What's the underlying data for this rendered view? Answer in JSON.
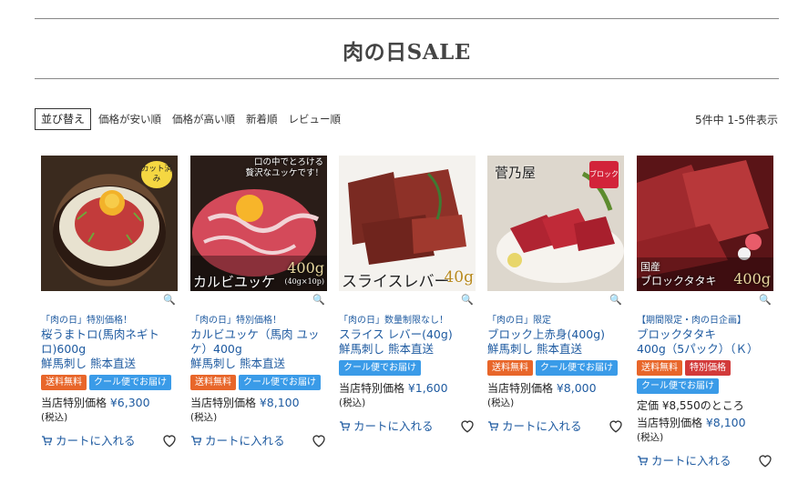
{
  "header": {
    "title": "肉の日SALE"
  },
  "sort": {
    "label": "並び替え",
    "options": [
      "価格が安い順",
      "価格が高い順",
      "新着順",
      "レビュー順"
    ]
  },
  "result_count": "5件中 1-5件表示",
  "products": [
    {
      "promo": "「肉の日」特別価格！",
      "name": "桜うまトロ(馬肉ネギトロ)600g\n鮮馬刺し 熊本直送",
      "badges": [
        {
          "text": "送料無料",
          "color": "#e8662a"
        },
        {
          "text": "クール便でお届け",
          "color": "#3a9be8"
        }
      ],
      "price_label": "当店特別価格",
      "price": "¥6,300",
      "tax": "(税込)",
      "cart": "カートに入れる",
      "image_tag": "カット済み"
    },
    {
      "promo": "「肉の日」特別価格！",
      "name": "カルビユッケ（馬肉 ユッケ）400g\n鮮馬刺し 熊本直送",
      "badges": [
        {
          "text": "送料無料",
          "color": "#e8662a"
        },
        {
          "text": "クール便でお届け",
          "color": "#3a9be8"
        }
      ],
      "price_label": "当店特別価格",
      "price": "¥8,100",
      "tax": "(税込)",
      "cart": "カートに入れる",
      "image_caption_top": "口の中でとろける\n贅沢なユッケです！",
      "image_caption": "カルビユッケ",
      "image_weight": "400g",
      "image_weight_sub": "(40g×10p)"
    },
    {
      "promo": "「肉の日」数量制限なし！",
      "name": "スライス レバー(40g)\n鮮馬刺し 熊本直送",
      "badges": [
        {
          "text": "クール便でお届け",
          "color": "#3a9be8"
        }
      ],
      "price_label": "当店特別価格",
      "price": "¥1,600",
      "tax": "(税込)",
      "cart": "カートに入れる",
      "image_caption": "スライスレバー",
      "image_weight": "40g"
    },
    {
      "promo": "「肉の日」限定",
      "name": "ブロック上赤身(400g)\n鮮馬刺し 熊本直送",
      "badges": [
        {
          "text": "送料無料",
          "color": "#e8662a"
        },
        {
          "text": "クール便でお届け",
          "color": "#3a9be8"
        }
      ],
      "price_label": "当店特別価格",
      "price": "¥8,000",
      "tax": "(税込)",
      "cart": "カートに入れる",
      "image_tag": "ブロック",
      "image_brand": "菅乃屋"
    },
    {
      "promo": "【期間限定・肉の日企画】",
      "name": "ブロックタタキ\n400g（5パック）（Ｋ）",
      "badges": [
        {
          "text": "送料無料",
          "color": "#e8662a"
        },
        {
          "text": "特別価格",
          "color": "#d23a3a"
        },
        {
          "text": "クール便でお届け",
          "color": "#3a9be8"
        }
      ],
      "regular": "定価 ¥8,550のところ",
      "price_label": "当店特別価格",
      "price": "¥8,100",
      "tax": "(税込)",
      "cart": "カートに入れる",
      "image_caption_top": "国産",
      "image_caption": "ブロックタタキ",
      "image_weight": "400g"
    }
  ]
}
